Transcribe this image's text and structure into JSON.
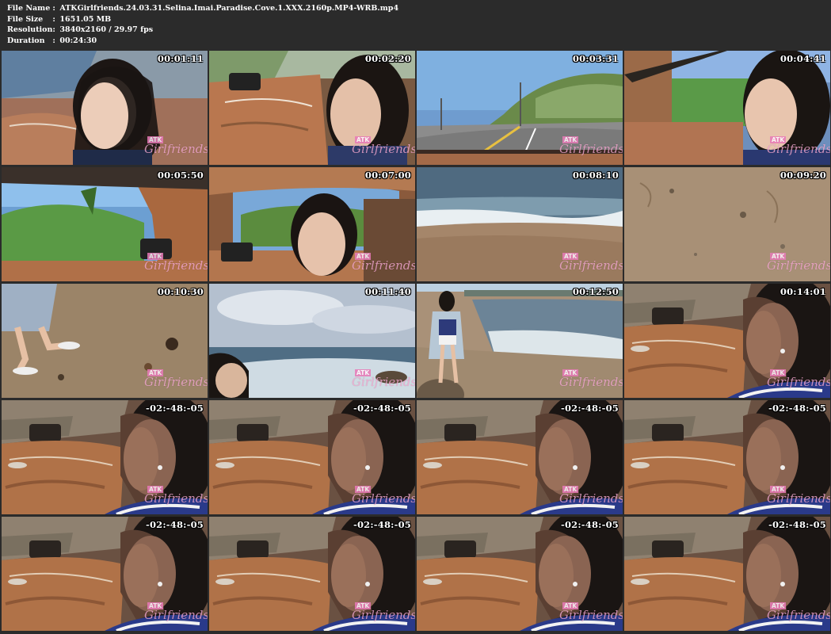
{
  "info": {
    "file_name_label": "File Name",
    "file_name_value": "ATKGirlfriends.24.03.31.Selina.Imai.Paradise.Cove.1.XXX.2160p.MP4-WRB.mp4",
    "file_size_label": "File Size",
    "file_size_value": "1651.05 MB",
    "resolution_label": "Resolution",
    "resolution_value": "3840x2160 / 29.97 fps",
    "duration_label": "Duration",
    "duration_value": "00:24:30",
    "separator": ":"
  },
  "watermark": {
    "brand_top": "ATK",
    "brand_script": "Girlfriends"
  },
  "thumbnails": [
    {
      "time": "00:01:11",
      "scene": "car-woman-left"
    },
    {
      "time": "00:02:20",
      "scene": "car-door-woman"
    },
    {
      "time": "00:03:31",
      "scene": "road-highway"
    },
    {
      "time": "00:04:41",
      "scene": "car-park-woman"
    },
    {
      "time": "00:05:50",
      "scene": "car-hill"
    },
    {
      "time": "00:07:00",
      "scene": "car-woman-center"
    },
    {
      "time": "00:08:10",
      "scene": "beach-waves"
    },
    {
      "time": "00:09:20",
      "scene": "sand-closeup"
    },
    {
      "time": "00:10:30",
      "scene": "beach-feet"
    },
    {
      "time": "00:11:40",
      "scene": "ocean-sky"
    },
    {
      "time": "00:12:50",
      "scene": "beach-walking"
    },
    {
      "time": "00:14:01",
      "scene": "car-profile"
    },
    {
      "time": "-02:-48:-05",
      "scene": "car-profile"
    },
    {
      "time": "-02:-48:-05",
      "scene": "car-profile"
    },
    {
      "time": "-02:-48:-05",
      "scene": "car-profile"
    },
    {
      "time": "-02:-48:-05",
      "scene": "car-profile"
    },
    {
      "time": "-02:-48:-05",
      "scene": "car-profile"
    },
    {
      "time": "-02:-48:-05",
      "scene": "car-profile"
    },
    {
      "time": "-02:-48:-05",
      "scene": "car-profile"
    },
    {
      "time": "-02:-48:-05",
      "scene": "car-profile"
    }
  ]
}
